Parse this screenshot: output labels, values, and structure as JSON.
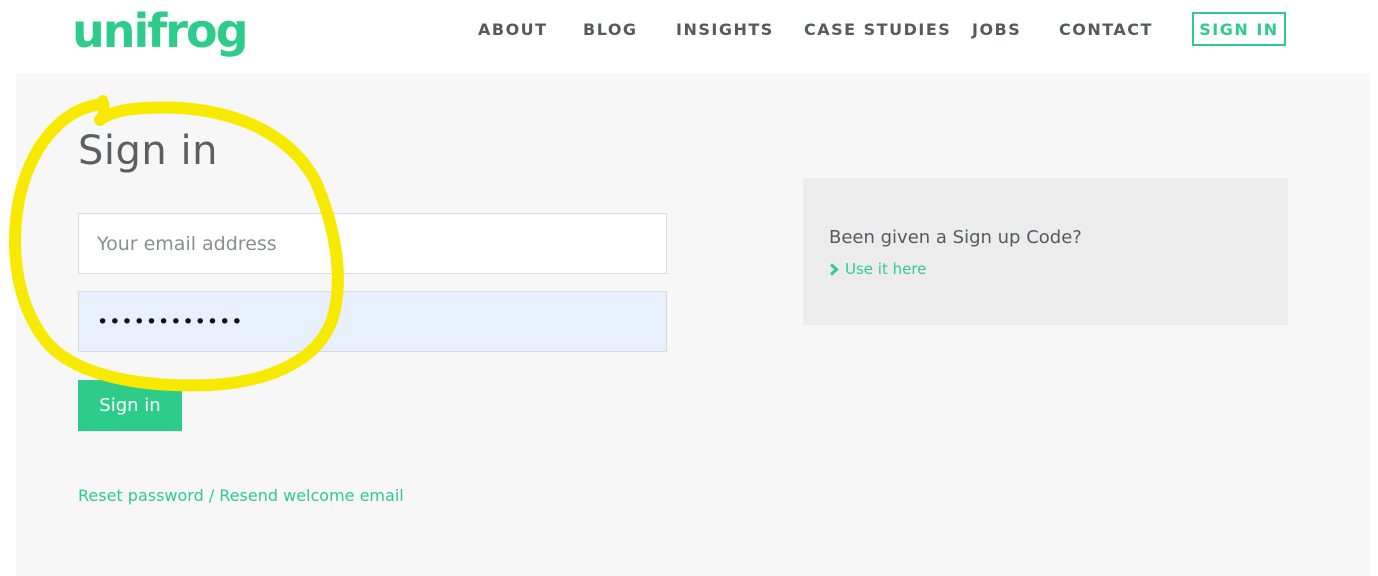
{
  "header": {
    "logo_text": "unifrog",
    "nav": {
      "about": "ABOUT",
      "blog": "BLOG",
      "insights": "INSIGHTS",
      "case_studies": "CASE STUDIES",
      "jobs": "JOBS",
      "contact": "CONTACT",
      "sign_in": "SIGN IN"
    }
  },
  "form": {
    "title": "Sign in",
    "email_placeholder": "Your email address",
    "email_value": "",
    "password_value": "••••••••••••",
    "submit_label": "Sign in",
    "reset_link": "Reset password / Resend welcome email"
  },
  "sidebar": {
    "question": "Been given a Sign up Code?",
    "link_label": "Use it here",
    "link_icon": "chevron-right-icon"
  },
  "colors": {
    "brand_green": "#2ecc8a",
    "annotation_yellow": "#f7ea00",
    "autofill_blue": "#e8f0fe"
  }
}
